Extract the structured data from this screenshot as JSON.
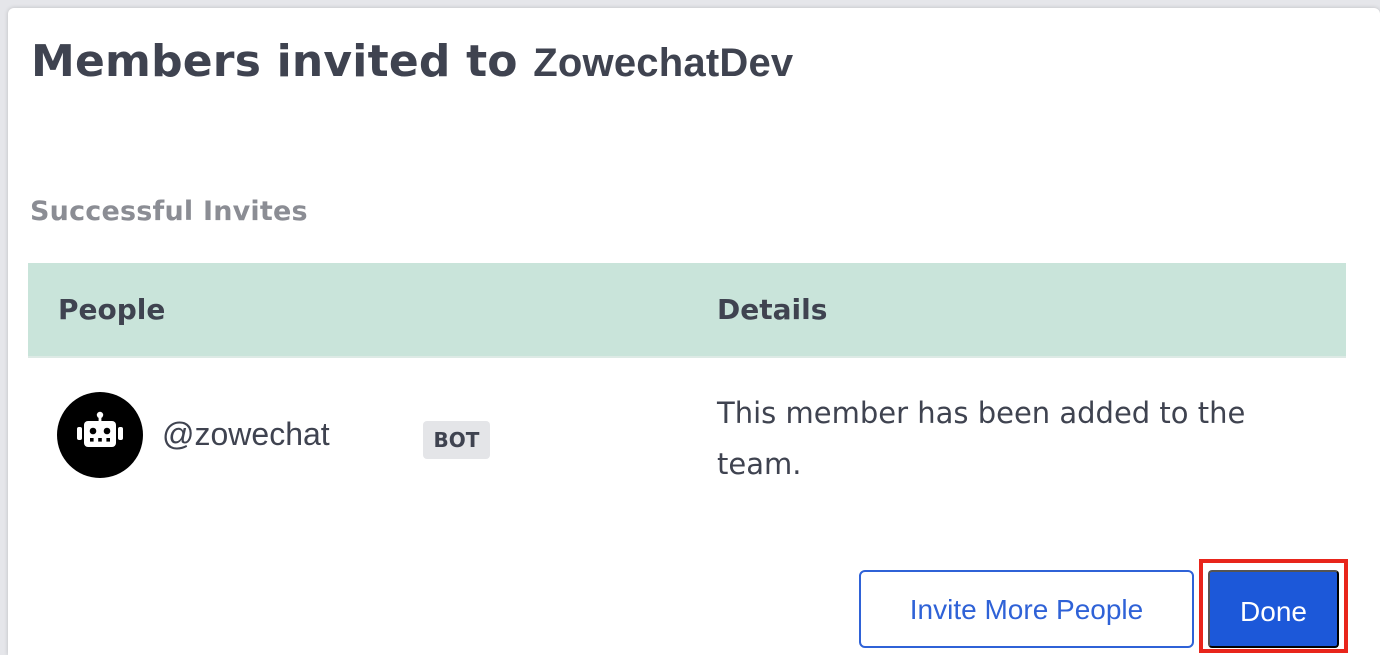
{
  "modal": {
    "title_prefix": "Members invited to",
    "team_name": "ZowechatDev"
  },
  "section": {
    "heading": "Successful Invites"
  },
  "table": {
    "columns": [
      "People",
      "Details"
    ],
    "rows": [
      {
        "avatar_icon": "robot-icon",
        "username": "@zowechat",
        "badge": "BOT",
        "details": "This member has been added to the team."
      }
    ]
  },
  "buttons": {
    "invite_more": "Invite More People",
    "done": "Done"
  },
  "colors": {
    "header_bg": "#c9e4da",
    "primary": "#1c58d9",
    "highlight": "#e8251b",
    "text": "#3f4350"
  }
}
